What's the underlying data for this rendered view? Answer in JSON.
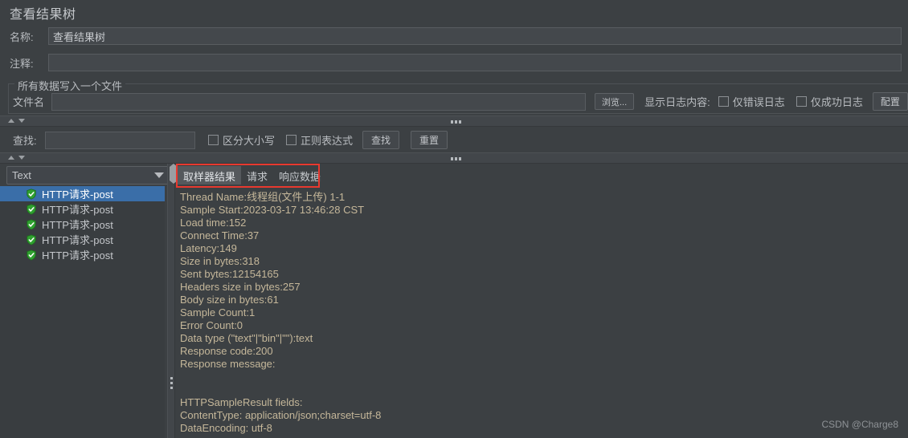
{
  "window": {
    "title": "查看结果树",
    "background": "#3c4043",
    "accent": "#3a6ea8",
    "highlight_border": "#e8392f"
  },
  "form": {
    "name_label": "名称:",
    "name_value": "查看结果树",
    "comment_label": "注释:",
    "comment_value": "",
    "comment_placeholder": ""
  },
  "filegroup": {
    "legend": "所有数据写入一个文件",
    "filename_label": "文件名",
    "filename_value": "",
    "browse_label": "浏览...",
    "log_display_label": "显示日志内容:",
    "errors_only_label": "仅错误日志",
    "errors_only_checked": false,
    "success_only_label": "仅成功日志",
    "success_only_checked": false,
    "configure_label": "配置"
  },
  "search": {
    "label": "查找:",
    "value": "",
    "case_sensitive_label": "区分大小写",
    "case_sensitive_checked": false,
    "regex_label": "正则表达式",
    "regex_checked": false,
    "find_button": "查找",
    "reset_button": "重置"
  },
  "renderer": {
    "selected": "Text",
    "options": [
      "Text"
    ]
  },
  "tree": {
    "items": [
      {
        "label": "HTTP请求-post",
        "status": "success",
        "selected": true
      },
      {
        "label": "HTTP请求-post",
        "status": "success",
        "selected": false
      },
      {
        "label": "HTTP请求-post",
        "status": "success",
        "selected": false
      },
      {
        "label": "HTTP请求-post",
        "status": "success",
        "selected": false
      },
      {
        "label": "HTTP请求-post",
        "status": "success",
        "selected": false
      }
    ],
    "status_icon": "green-shield-check-icon"
  },
  "tabs": [
    {
      "label": "取样器结果",
      "active": true
    },
    {
      "label": "请求",
      "active": false
    },
    {
      "label": "响应数据",
      "active": false
    }
  ],
  "sampler_result": {
    "lines": [
      "Thread Name:线程组(文件上传) 1-1",
      "Sample Start:2023-03-17 13:46:28 CST",
      "Load time:152",
      "Connect Time:37",
      "Latency:149",
      "Size in bytes:318",
      "Sent bytes:12154165",
      "Headers size in bytes:257",
      "Body size in bytes:61",
      "Sample Count:1",
      "Error Count:0",
      "Data type (\"text\"|\"bin\"|\"\"):text",
      "Response code:200",
      "Response message:",
      "",
      "",
      "HTTPSampleResult fields:",
      "ContentType: application/json;charset=utf-8",
      "DataEncoding: utf-8"
    ]
  },
  "watermark": "CSDN @Charge8"
}
